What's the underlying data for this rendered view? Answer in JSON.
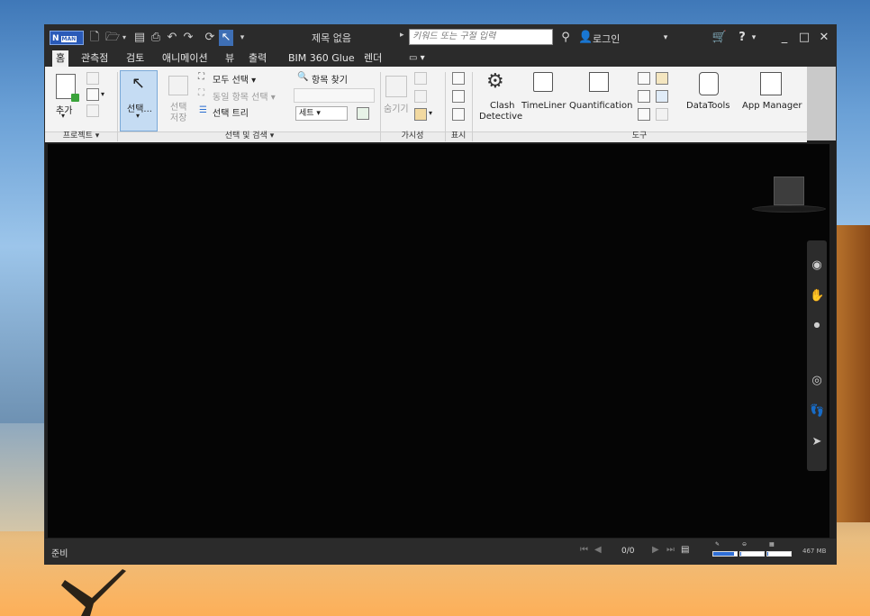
{
  "window": {
    "title": "제목 없음",
    "app_logo": "N",
    "app_logo_sub": "MAN",
    "search_placeholder": "키워드 또는 구절 입력",
    "login_label": "로그인",
    "help_label": "?",
    "minimize": "_",
    "maximize": "□",
    "close": "✕"
  },
  "tabs": [
    "홈",
    "관측점",
    "검토",
    "애니메이션",
    "뷰",
    "출력",
    "BIM 360 Glue",
    "렌더"
  ],
  "active_tab": 0,
  "ribbon": {
    "project": {
      "add_label": "추가",
      "group_label": "프로젝트 ▾"
    },
    "select_search": {
      "select_label": "선택...",
      "save_selection_label": "선택 저장",
      "select_all_label": "모두 선택 ▾",
      "select_same_label": "동일 항목 선택 ▾",
      "selection_tree_label": "선택 트리",
      "find_items_label": "항목 찾기",
      "sets_label": "세트 ▾",
      "group_label": "선택 및 검색 ▾"
    },
    "visibility": {
      "hide_label": "숨기기",
      "group_label": "가시성"
    },
    "display": {
      "group_label": "표시"
    },
    "tools": {
      "clash_label_1": "Clash",
      "clash_label_2": "Detective",
      "timeliner_label": "TimeLiner",
      "quantification_label": "Quantification",
      "datatools_label": "DataTools",
      "app_manager_label": "App Manager",
      "group_label": "도구"
    }
  },
  "statusbar": {
    "status": "준비",
    "page_count": "0/0",
    "memory": "467 MB",
    "gauges": [
      0.9,
      0.05,
      0.05
    ]
  },
  "colors": {
    "accent": "#3e6fb5",
    "viewport": "#050505",
    "chrome": "#2b2b2b",
    "ribbon": "#f3f3f3"
  }
}
